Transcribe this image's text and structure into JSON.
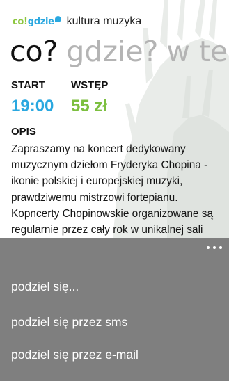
{
  "app": {
    "logo": {
      "co": "co",
      "separator": "!",
      "gdzie": "gdzie"
    },
    "header_title": "kultura muzyka"
  },
  "pivot": {
    "items": [
      "co?",
      "gdzie?",
      "w te"
    ],
    "active_index": 0
  },
  "event": {
    "start_label": "START",
    "start_value": "19:00",
    "entry_label": "WSTĘP",
    "entry_value": "55 zł",
    "description_label": "OPIS",
    "description": "Zapraszamy na koncert dedykowany muzycznym dziełom Fryderyka Chopina - ikonie polskiej i europejskiej muzyki, prawdziwemu mistrzowi fortepianu. Kopncerty Chopinowskie organizowane są regularnie przez cały rok w unikalnej sali renesansowej. AD"
  },
  "app_bar_menu": {
    "items": [
      {
        "label": "podziel się..."
      },
      {
        "label": "podziel się przez sms"
      },
      {
        "label": "podziel się przez e-mail"
      }
    ]
  },
  "colors": {
    "accent_blue": "#2aa8e0",
    "accent_green": "#7cbf3f",
    "menu_background": "#7f7f7f",
    "pivot_inactive": "#b4b4b4"
  }
}
